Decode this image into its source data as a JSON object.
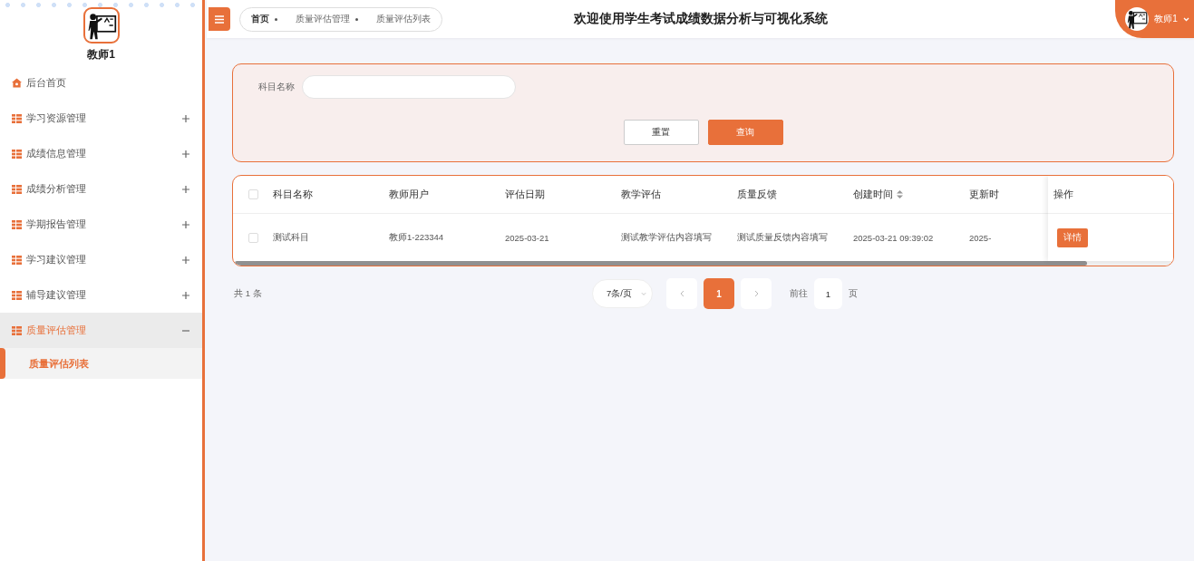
{
  "sidebar": {
    "user": {
      "name": "教师1"
    },
    "menu": [
      {
        "kind": "home",
        "label": "后台首页",
        "selected": false
      },
      {
        "kind": "group",
        "label": "学习资源管理",
        "selected": false,
        "expanded": false
      },
      {
        "kind": "group",
        "label": "成绩信息管理",
        "selected": false,
        "expanded": false
      },
      {
        "kind": "group",
        "label": "成绩分析管理",
        "selected": false,
        "expanded": false
      },
      {
        "kind": "group",
        "label": "学期报告管理",
        "selected": false,
        "expanded": false
      },
      {
        "kind": "group",
        "label": "学习建议管理",
        "selected": false,
        "expanded": false
      },
      {
        "kind": "group",
        "label": "辅导建议管理",
        "selected": false,
        "expanded": false
      },
      {
        "kind": "group",
        "label": "质量评估管理",
        "selected": true,
        "expanded": true,
        "children": [
          {
            "label": "质量评估列表",
            "selected": true
          }
        ]
      }
    ]
  },
  "header": {
    "breadcrumbs": [
      "首页",
      "质量评估管理",
      "质量评估列表"
    ],
    "title": "欢迎使用学生考试成绩数据分析与可视化系统",
    "user": {
      "name": "教师1"
    }
  },
  "search": {
    "fields": [
      {
        "label": "科目名称"
      }
    ],
    "buttons": [
      {
        "label": "重置",
        "kind": "secondary"
      },
      {
        "label": "查询",
        "kind": "primary"
      }
    ]
  },
  "table": {
    "all_checked": false,
    "columns": [
      {
        "label": "科目名称",
        "sortable": false
      },
      {
        "label": "教师用户",
        "sortable": false
      },
      {
        "label": "评估日期",
        "sortable": false
      },
      {
        "label": "教学评估",
        "sortable": false
      },
      {
        "label": "质量反馈",
        "sortable": false
      },
      {
        "label": "创建时间",
        "sortable": true
      },
      {
        "label": "更新时",
        "sortable": false
      }
    ],
    "action_column": "操作",
    "rows": [
      {
        "checked": false,
        "cells": [
          "测试科目",
          "教师1-223344",
          "2025-03-21",
          "测试教学评估内容填写",
          "测试质量反馈内容填写",
          "2025-03-21 09:39:02",
          "2025-"
        ],
        "actions": [
          "详情"
        ]
      }
    ]
  },
  "pagination": {
    "total": "共 1 条",
    "page_size": "7条/页",
    "pages": [
      {
        "label": "1",
        "selected": true
      }
    ],
    "goto_label": "前往",
    "goto_value": "1",
    "goto_suffix": "页"
  }
}
